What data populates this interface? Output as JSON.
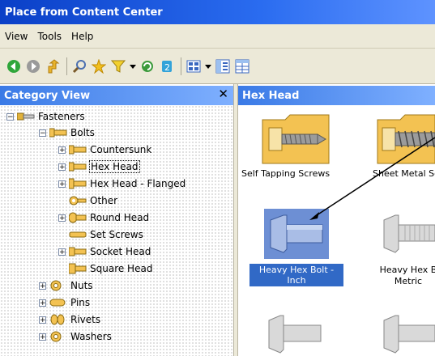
{
  "window": {
    "title": "Place from Content Center"
  },
  "menu": {
    "items": [
      "View",
      "Tools",
      "Help"
    ]
  },
  "toolbar": {
    "buttons": [
      "back-icon",
      "forward-icon",
      "up-icon",
      "search-icon",
      "favorites-icon",
      "filter-icon",
      "dropdown-icon",
      "refresh-icon",
      "update-icon",
      "view-icon",
      "dropdown-icon",
      "tree-view-icon",
      "table-view-icon"
    ]
  },
  "category_view": {
    "title": "Category View",
    "close": "✕",
    "tree": [
      {
        "label": "Fasteners",
        "expanded": true
      },
      {
        "label": "Bolts",
        "expanded": true
      },
      {
        "label": "Countersunk"
      },
      {
        "label": "Hex Head",
        "selected": true
      },
      {
        "label": "Hex Head - Flanged"
      },
      {
        "label": "Other"
      },
      {
        "label": "Round Head"
      },
      {
        "label": "Set Screws"
      },
      {
        "label": "Socket Head"
      },
      {
        "label": "Square Head"
      },
      {
        "label": "Nuts"
      },
      {
        "label": "Pins"
      },
      {
        "label": "Rivets"
      },
      {
        "label": "Washers"
      }
    ]
  },
  "content_view": {
    "title": "Hex Head",
    "items": [
      {
        "label": "Self Tapping Screws"
      },
      {
        "label": "Sheet Metal Sc"
      },
      {
        "label_line1": "Heavy Hex Bolt -",
        "label_line2": "Inch",
        "selected": true
      },
      {
        "label_line1": "Heavy Hex B",
        "label_line2": "Metric"
      }
    ]
  },
  "colors": {
    "title_bar": "#0a3fc7",
    "header": "#3a7ae6",
    "selection": "#3169c6",
    "folder": "#f3c252"
  }
}
